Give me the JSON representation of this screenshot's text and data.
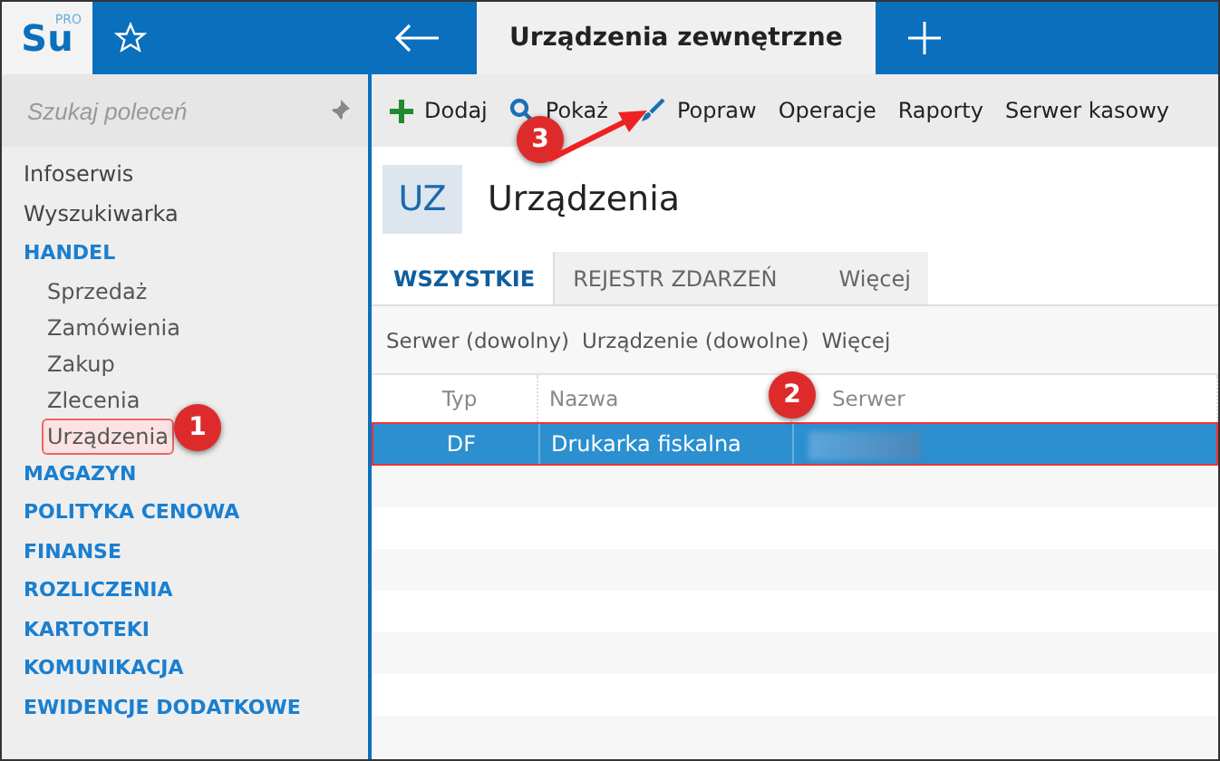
{
  "app": {
    "logo": "Su",
    "logo_badge": "PRO"
  },
  "tabs": [
    {
      "label": "Urządzenia zewnętrzne",
      "selected": true
    }
  ],
  "search": {
    "placeholder": "Szukaj poleceń"
  },
  "sidebar": {
    "items": [
      {
        "label": "Infoserwis",
        "kind": "link",
        "selected": false
      },
      {
        "label": "Wyszukiwarka",
        "kind": "link",
        "selected": false
      },
      {
        "label": "HANDEL",
        "kind": "section",
        "selected": false,
        "children": [
          {
            "label": "Sprzedaż",
            "selected": false
          },
          {
            "label": "Zamówienia",
            "selected": false
          },
          {
            "label": "Zakup",
            "selected": false
          },
          {
            "label": "Zlecenia",
            "selected": false
          },
          {
            "label": "Urządzenia",
            "selected": true
          }
        ]
      },
      {
        "label": "MAGAZYN",
        "kind": "section",
        "selected": false
      },
      {
        "label": "POLITYKA CENOWA",
        "kind": "section",
        "selected": false
      },
      {
        "label": "FINANSE",
        "kind": "section",
        "selected": false
      },
      {
        "label": "ROZLICZENIA",
        "kind": "section",
        "selected": false
      },
      {
        "label": "KARTOTEKI",
        "kind": "section",
        "selected": false
      },
      {
        "label": "KOMUNIKACJA",
        "kind": "section",
        "selected": false
      },
      {
        "label": "EWIDENCJE DODATKOWE",
        "kind": "section",
        "selected": false
      }
    ]
  },
  "toolbar": [
    {
      "label": "Dodaj",
      "kind": "add"
    },
    {
      "label": "Pokaż",
      "kind": "show"
    },
    {
      "label": "Popraw",
      "kind": "edit"
    },
    {
      "label": "Operacje",
      "kind": "text"
    },
    {
      "label": "Raporty",
      "kind": "text"
    },
    {
      "label": "Serwer kasowy",
      "kind": "text"
    }
  ],
  "page": {
    "code": "UZ",
    "title": "Urządzenia"
  },
  "view_tabs": [
    {
      "label": "WSZYSTKIE",
      "selected": true
    },
    {
      "label": "REJESTR ZDARZEŃ",
      "selected": false
    },
    {
      "label": "Więcej",
      "selected": false
    }
  ],
  "filters": [
    "Serwer (dowolny)",
    "Urządzenie (dowolne)",
    "Więcej"
  ],
  "table": {
    "columns": [
      "Typ",
      "Nazwa",
      "Serwer"
    ],
    "rows": [
      {
        "cells": [
          "DF",
          "Drukarka fiskalna"
        ],
        "selected": true
      }
    ]
  },
  "annotations": [
    {
      "number": "1"
    },
    {
      "number": "2"
    },
    {
      "number": "3"
    }
  ]
}
